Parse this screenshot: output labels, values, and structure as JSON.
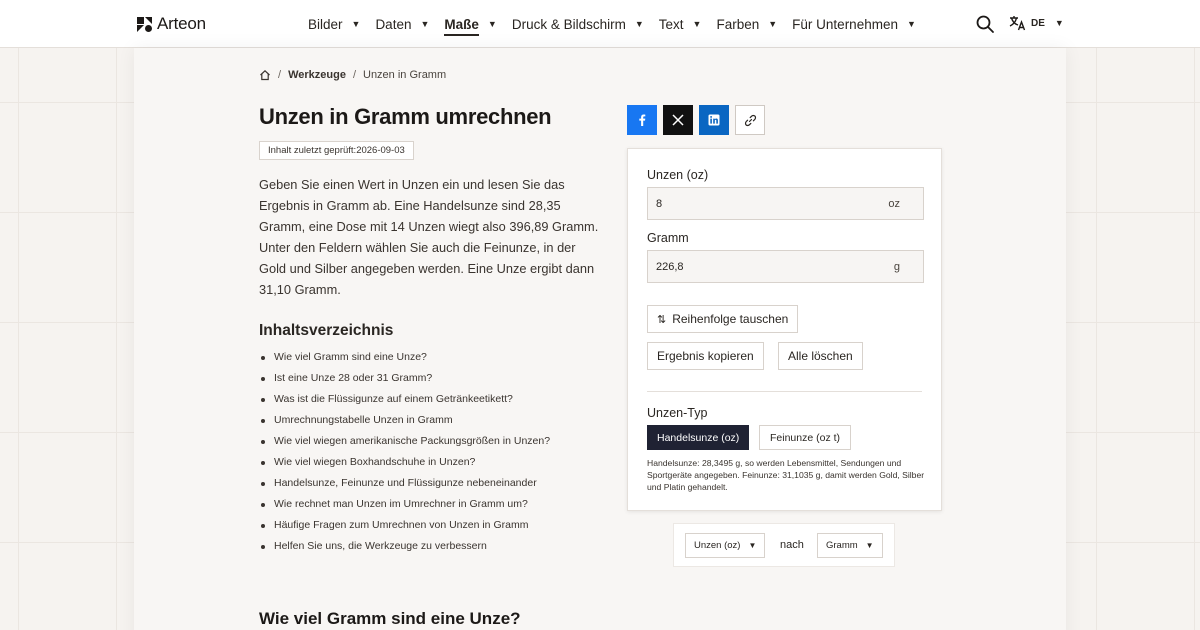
{
  "header": {
    "brand": "Arteon",
    "nav": [
      {
        "label": "Bilder",
        "active": false
      },
      {
        "label": "Daten",
        "active": false
      },
      {
        "label": "Maße",
        "active": true
      },
      {
        "label": "Druck & Bildschirm",
        "active": false
      },
      {
        "label": "Text",
        "active": false
      },
      {
        "label": "Farben",
        "active": false
      },
      {
        "label": "Für Unternehmen",
        "active": false
      }
    ],
    "language_code": "DE"
  },
  "breadcrumb": {
    "section": "Werkzeuge",
    "current": "Unzen in Gramm"
  },
  "page": {
    "title": "Unzen in Gramm umrechnen",
    "reviewed": "Inhalt zuletzt geprüft:2026-09-03",
    "intro": "Geben Sie einen Wert in Unzen ein und lesen Sie das Ergebnis in Gramm ab. Eine Handelsunze sind 28,35 Gramm, eine Dose mit 14 Unzen wiegt also 396,89 Gramm. Unter den Feldern wählen Sie auch die Feinunze, in der Gold und Silber angegeben werden. Eine Unze ergibt dann 31,10 Gramm.",
    "toc_title": "Inhaltsverzeichnis",
    "toc": [
      "Wie viel Gramm sind eine Unze?",
      "Ist eine Unze 28 oder 31 Gramm?",
      "Was ist die Flüssigunze auf einem Getränkeetikett?",
      "Umrechnungstabelle Unzen in Gramm",
      "Wie viel wiegen amerikanische Packungsgrößen in Unzen?",
      "Wie viel wiegen Boxhandschuhe in Unzen?",
      "Handelsunze, Feinunze und Flüssigunze nebeneinander",
      "Wie rechnet man Unzen im Umrechner in Gramm um?",
      "Häufige Fragen zum Umrechnen von Unzen in Gramm",
      "Helfen Sie uns, die Werkzeuge zu verbessern"
    ],
    "section_heading": "Wie viel Gramm sind eine Unze?"
  },
  "converter": {
    "from_label": "Unzen (oz)",
    "from_value": "8",
    "from_unit": "oz",
    "to_label": "Gramm",
    "to_value": "226,8",
    "to_unit": "g",
    "swap_label": "Reihenfolge tauschen",
    "copy_label": "Ergebnis kopieren",
    "clear_label": "Alle löschen",
    "type_label": "Unzen-Typ",
    "type_options": [
      "Handelsunze (oz)",
      "Feinunze (oz t)"
    ],
    "type_selected": "Handelsunze (oz)",
    "type_note": "Handelsunze: 28,3495 g, so werden Lebensmittel, Sendungen und Sportgeräte angegeben. Feinunze: 31,1035 g, damit werden Gold, Silber und Platin gehandelt."
  },
  "unit_selector": {
    "from": "Unzen (oz)",
    "connector": "nach",
    "to": "Gramm"
  },
  "colors": {
    "facebook": "#1877f2",
    "x": "#111111",
    "linkedin": "#0a66c2",
    "selected_segment": "#1f2233"
  }
}
